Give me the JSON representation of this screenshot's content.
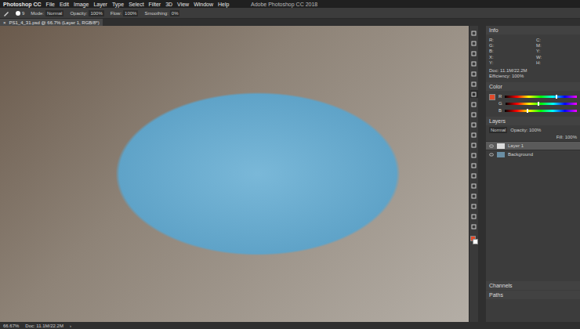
{
  "window": {
    "title": "Adobe Photoshop CC 2018"
  },
  "app_name": "Photoshop CC",
  "menu": [
    "File",
    "Edit",
    "Image",
    "Layer",
    "Type",
    "Select",
    "Filter",
    "3D",
    "View",
    "Window",
    "Help"
  ],
  "options_bar": {
    "brush_size": "9",
    "fields": [
      {
        "label": "Mode:",
        "value": "Normal"
      },
      {
        "label": "Opacity:",
        "value": "100%"
      },
      {
        "label": "Flow:",
        "value": "100%"
      },
      {
        "label": "Smoothing:",
        "value": "0%"
      }
    ]
  },
  "document_tab": {
    "label": "PS1_4_31.psd @ 66.7% (Layer 1, RGB/8*)",
    "close": "×"
  },
  "tools": [
    {
      "selected": false
    },
    {
      "selected": false
    },
    {
      "selected": false
    },
    {
      "selected": false
    },
    {
      "selected": false
    },
    {
      "selected": false
    },
    {
      "selected": true
    },
    {
      "selected": false
    },
    {
      "selected": false
    },
    {
      "selected": false
    },
    {
      "selected": false
    },
    {
      "selected": false
    },
    {
      "selected": false
    },
    {
      "selected": false
    },
    {
      "selected": false
    },
    {
      "selected": false
    },
    {
      "selected": false
    },
    {
      "selected": false
    },
    {
      "selected": false
    },
    {
      "selected": false
    }
  ],
  "info_panel": {
    "title": "Info",
    "rows": [
      [
        "R:",
        "G:",
        "B:"
      ],
      [
        "C:",
        "M:",
        "Y:"
      ],
      [
        "X:",
        "Y:"
      ],
      [
        "W:",
        "H:"
      ]
    ],
    "doc": "Doc: 11.1M/22.2M",
    "note": "Efficiency: 100%"
  },
  "color_panel": {
    "title": "Color",
    "sliders": [
      {
        "name": "R",
        "level": 0.7
      },
      {
        "name": "G",
        "level": 0.45
      },
      {
        "name": "B",
        "level": 0.3
      }
    ]
  },
  "layers_panel": {
    "title": "Layers",
    "blend": "Normal",
    "opacity": "Opacity: 100%",
    "fill": "Fill: 100%",
    "layers": [
      {
        "name": "Layer 1",
        "selected": true,
        "visible": true
      },
      {
        "name": "Background",
        "selected": false,
        "visible": true
      }
    ]
  },
  "channels_panel": {
    "title": "Channels"
  },
  "paths_panel": {
    "title": "Paths"
  },
  "status_bar": {
    "zoom": "66.67%",
    "doc": "Doc: 11.1M/22.2M",
    "arrow": "›"
  }
}
